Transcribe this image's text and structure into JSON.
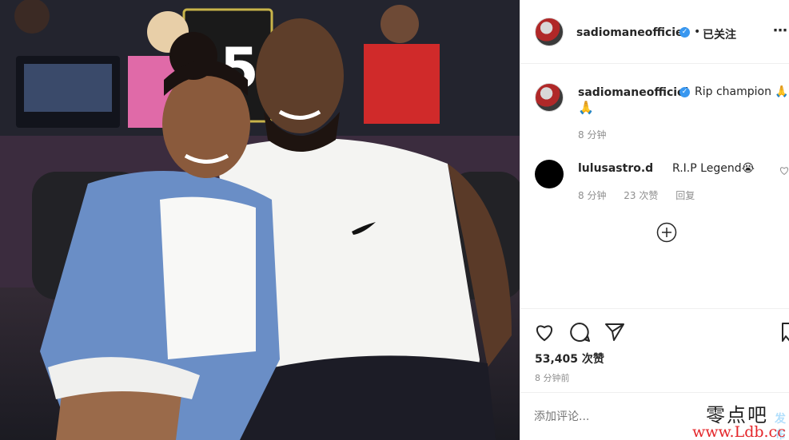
{
  "header": {
    "username": "sadiomaneofficiel",
    "follow_separator": "•",
    "follow_status": "已关注"
  },
  "caption": {
    "username": "sadiomaneofficiel",
    "text": "Rip champion 🙏",
    "text_line2": "🙏",
    "time": "8 分钟"
  },
  "comment": {
    "username": "lulusastro.d",
    "text": "R.I.P Legend😭",
    "time": "8 分钟",
    "likes": "23 次赞",
    "reply": "回复"
  },
  "actions": {
    "likes": "53,405 次赞",
    "time": "8 分钟前"
  },
  "add_comment": {
    "placeholder": "添加评论...",
    "post_label": "发布"
  },
  "watermark": {
    "line1": "零点吧",
    "line2": "www.Ldb.cc"
  },
  "colors": {
    "verified": "#3897f0",
    "muted": "#8e8e8e",
    "text": "#262626",
    "post_disabled": "#b2dffc"
  }
}
